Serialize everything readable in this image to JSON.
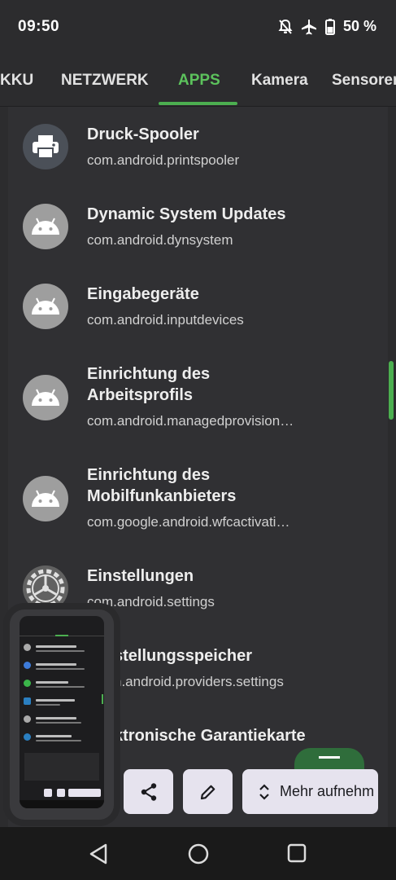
{
  "status": {
    "time": "09:50",
    "battery": "50 %"
  },
  "tabs": [
    {
      "label": "KKU",
      "active": false
    },
    {
      "label": "NETZWERK",
      "active": false
    },
    {
      "label": "APPS",
      "active": true
    },
    {
      "label": "Kamera",
      "active": false
    },
    {
      "label": "Sensoren",
      "active": false
    }
  ],
  "apps": [
    {
      "name": "Druck-Spooler",
      "package": "com.android.printspooler",
      "icon": "printer-icon"
    },
    {
      "name": "Dynamic System Updates",
      "package": "com.android.dynsystem",
      "icon": "android-icon"
    },
    {
      "name": "Eingabegeräte",
      "package": "com.android.inputdevices",
      "icon": "android-icon"
    },
    {
      "name": "Einrichtung des Arbeitsprofils",
      "package": "com.android.managedprovision…",
      "icon": "android-icon"
    },
    {
      "name": "Einrichtung des Mobilfunkanbieters",
      "package": "com.google.android.wfcactivati…",
      "icon": "android-icon"
    },
    {
      "name": "Einstellungen",
      "package": "com.android.settings",
      "icon": "settings-gear-icon"
    },
    {
      "name": "stellungsspeicher",
      "package": "n.android.providers.settings",
      "icon": "android-icon"
    },
    {
      "name": "ktronische Garantiekarte",
      "package": "",
      "icon": "android-icon"
    }
  ],
  "actions": {
    "share": "share-icon",
    "edit": "edit-icon",
    "capture_more": "Mehr aufnehm"
  },
  "colors": {
    "accent": "#4caf50",
    "background": "#303033",
    "chip": "#e6e3ee"
  }
}
